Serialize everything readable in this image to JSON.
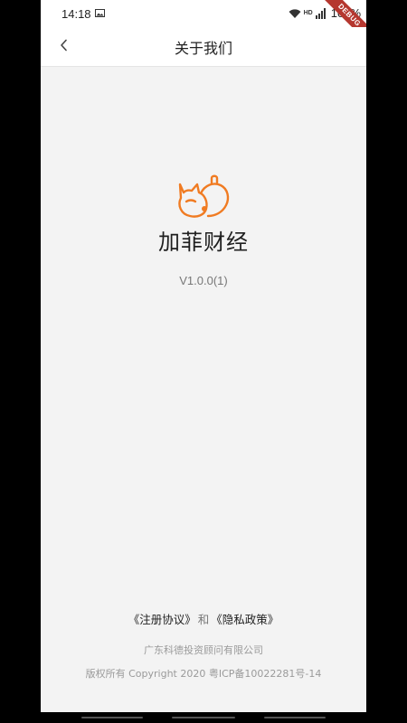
{
  "status_bar": {
    "time": "14:18",
    "battery": "100%",
    "hd": "HD",
    "debug_banner": "DEBUG"
  },
  "app_bar": {
    "title": "关于我们",
    "back_icon": "chevron-left-icon"
  },
  "about": {
    "app_name": "加菲财经",
    "version": "V1.0.0(1)",
    "logo_icon": "cat-logo-icon",
    "logo_color": "#f07b22"
  },
  "footer": {
    "register_agreement": "《注册协议》",
    "and_text": "和",
    "privacy_policy": "《隐私政策》",
    "company": "广东科德投资顾问有限公司",
    "copyright": "版权所有 Copyright 2020 粤ICP备10022281号-14"
  }
}
